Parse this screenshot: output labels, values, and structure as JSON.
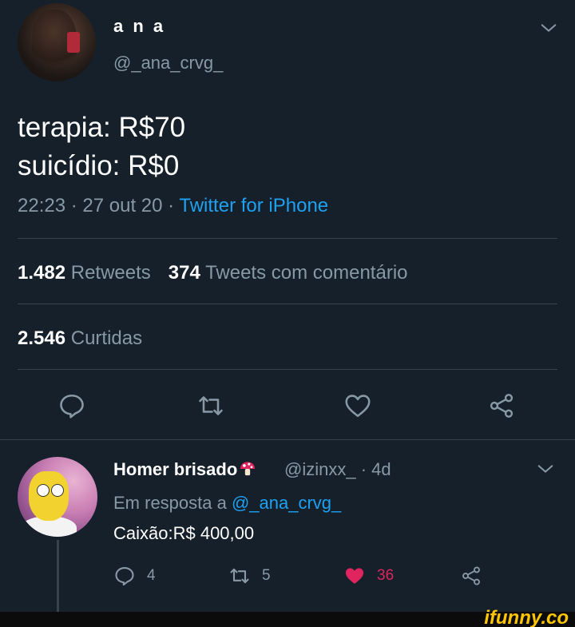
{
  "tweet": {
    "display_name": "a n a",
    "handle": "@_ana_crvg_",
    "body": "terapia: R$70\nsuicídio: R$0",
    "time": "22:23",
    "date": "27 out 20",
    "source": "Twitter for iPhone",
    "separator": " · "
  },
  "stats": {
    "retweets_count": "1.482",
    "retweets_label": "Retweets",
    "quotes_count": "374",
    "quotes_label": "Tweets com comentário",
    "likes_count": "2.546",
    "likes_label": "Curtidas"
  },
  "actions": {
    "reply_icon": "reply-icon",
    "retweet_icon": "retweet-icon",
    "like_icon": "heart-icon",
    "share_icon": "share-icon"
  },
  "reply": {
    "display_name": "Homer brisado",
    "emoji": "mushroom-icon",
    "handle": "@izinxx_",
    "age": "· 4d",
    "in_reply_prefix": "Em resposta a",
    "in_reply_mention": "@_ana_crvg_",
    "text": "Caixão:R$ 400,00",
    "reply_count": "4",
    "retweet_count": "5",
    "like_count": "36"
  },
  "watermark": "ifunny.co",
  "colors": {
    "background": "#15202b",
    "muted": "#8899a6",
    "link": "#1da1f2",
    "like": "#e0245e",
    "divider": "#38444d",
    "watermark": "#ffc500"
  }
}
